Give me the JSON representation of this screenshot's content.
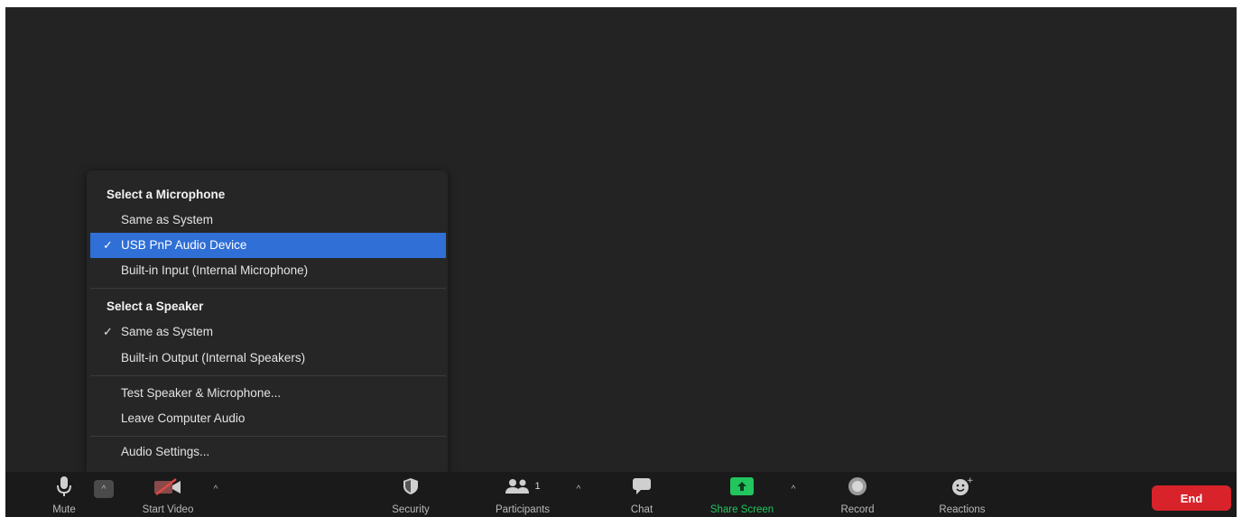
{
  "audio_menu": {
    "microphone_header": "Select a Microphone",
    "microphones": [
      {
        "label": "Same as System",
        "selected": false
      },
      {
        "label": "USB PnP Audio Device",
        "selected": true
      },
      {
        "label": "Built-in Input (Internal Microphone)",
        "selected": false
      }
    ],
    "speaker_header": "Select a Speaker",
    "speakers": [
      {
        "label": "Same as System",
        "selected": true
      },
      {
        "label": "Built-in Output (Internal Speakers)",
        "selected": false
      }
    ],
    "test_label": "Test Speaker & Microphone...",
    "leave_label": "Leave Computer Audio",
    "settings_label": "Audio Settings...",
    "check_glyph": "✓"
  },
  "toolbar": {
    "mute_label": "Mute",
    "start_video_label": "Start Video",
    "security_label": "Security",
    "participants_label": "Participants",
    "participants_count": "1",
    "chat_label": "Chat",
    "share_screen_label": "Share Screen",
    "record_label": "Record",
    "reactions_label": "Reactions",
    "end_label": "End",
    "caret_glyph": "^"
  },
  "colors": {
    "background": "#232323",
    "toolbar": "#1a1a1a",
    "selected_item": "#2f6fd6",
    "share_green": "#22c55e",
    "end_red": "#d8232a"
  },
  "icons": [
    "microphone-icon",
    "video-off-icon",
    "shield-icon",
    "participants-icon",
    "chat-icon",
    "share-screen-icon",
    "record-icon",
    "reactions-icon",
    "caret-up-icon"
  ]
}
